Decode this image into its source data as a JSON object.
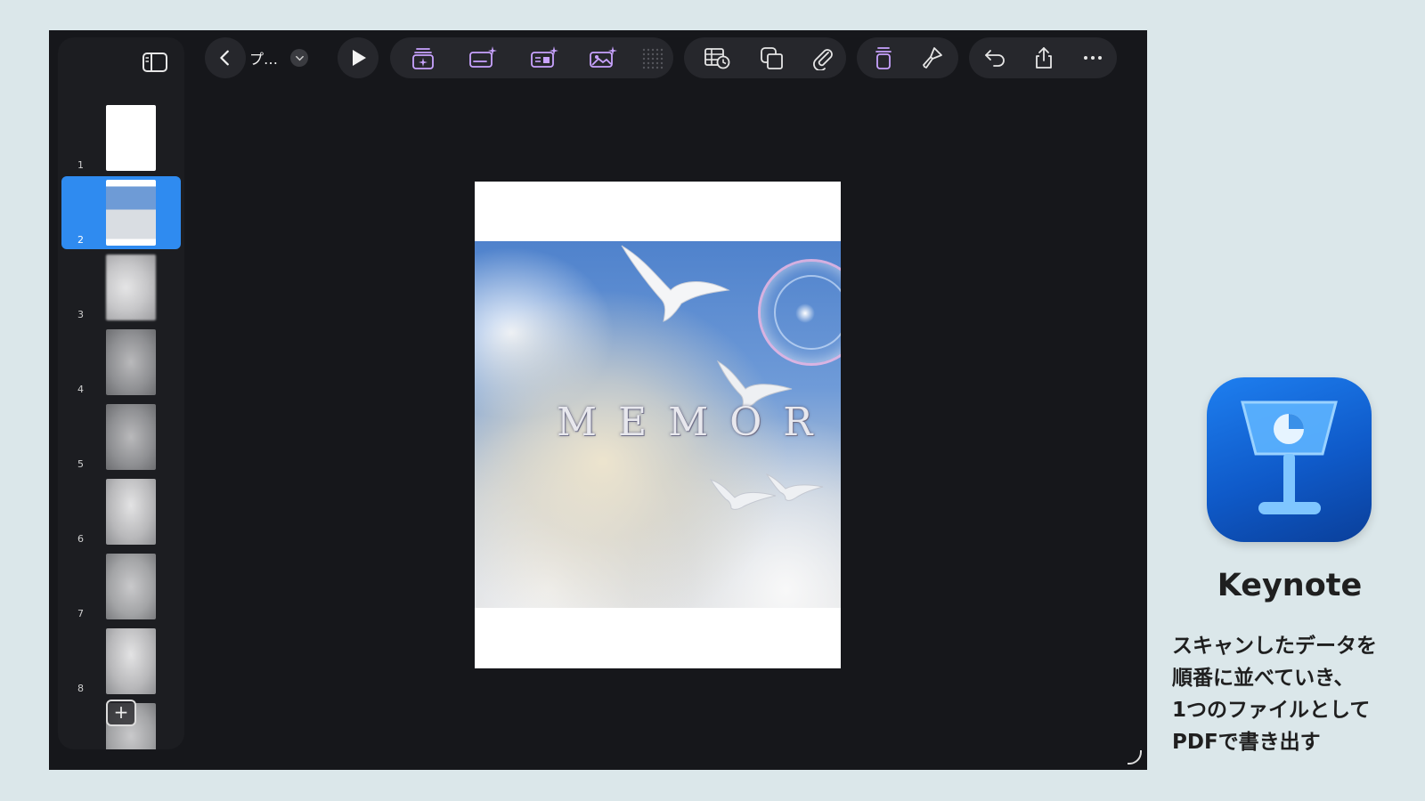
{
  "document": {
    "title": "プ…"
  },
  "slides": [
    {
      "number": "1",
      "kind": "blank"
    },
    {
      "number": "2",
      "kind": "sky",
      "selected": true
    },
    {
      "number": "3",
      "kind": "blur1"
    },
    {
      "number": "4",
      "kind": "blur2"
    },
    {
      "number": "5",
      "kind": "blur2"
    },
    {
      "number": "6",
      "kind": "blur3"
    },
    {
      "number": "7",
      "kind": "blur4"
    },
    {
      "number": "8",
      "kind": "blur3"
    }
  ],
  "slide_content": {
    "headline": "MEMOR"
  },
  "colors": {
    "accent": "#2f8bf0",
    "toolbar_icon": "#c9a3ff",
    "toolbar_icon_plain": "#e6e6e6"
  },
  "toolbar_icons": [
    "back-chevron-icon",
    "play-icon",
    "add-slide-ai-icon",
    "text-ai-icon",
    "shape-ai-icon",
    "image-ai-icon",
    "grid-icon",
    "table-chart-icon",
    "shapes-icon",
    "paperclip-icon",
    "trash-icon",
    "format-brush-icon",
    "undo-icon",
    "share-icon",
    "more-icon"
  ],
  "promo": {
    "app_name": "Keynote",
    "caption_lines": [
      "スキャンしたデータを",
      "順番に並べていき、",
      "1つのファイルとして",
      "PDFで書き出す"
    ]
  }
}
